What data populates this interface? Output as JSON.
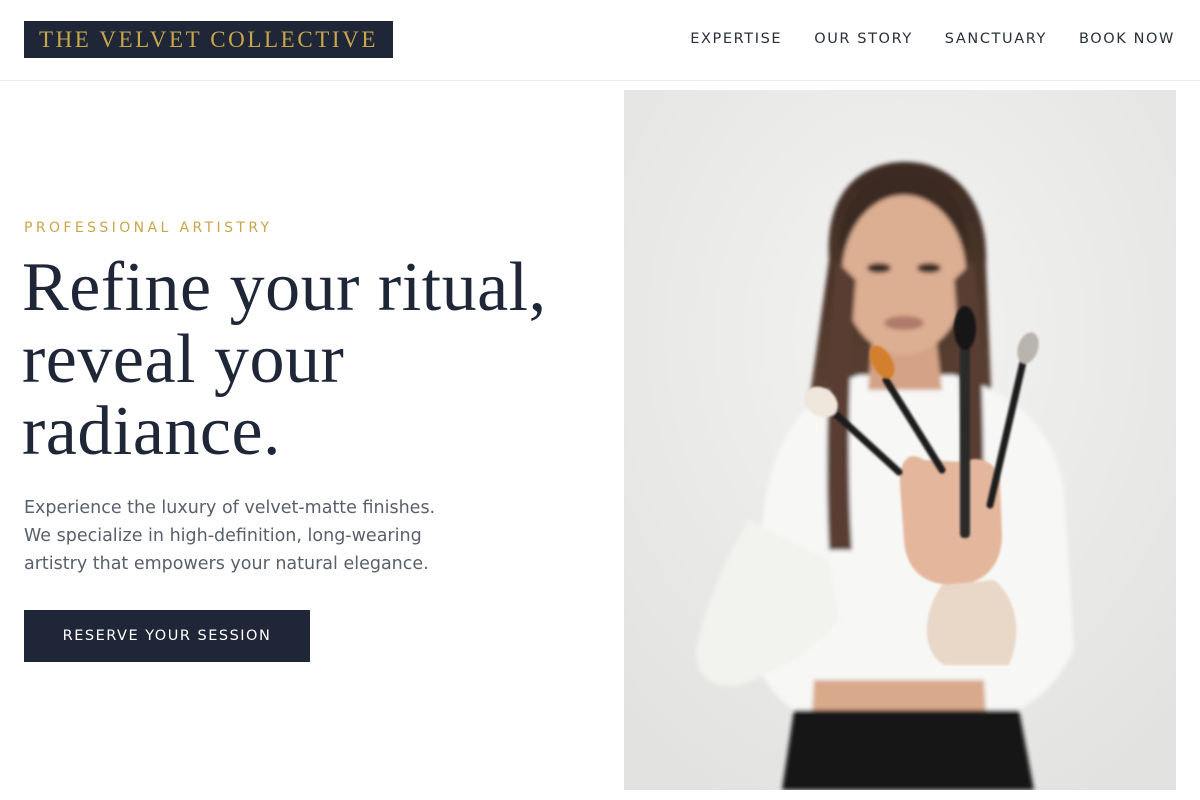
{
  "brand": {
    "name": "THE VELVET COLLECTIVE"
  },
  "nav": {
    "items": [
      {
        "label": "EXPERTISE"
      },
      {
        "label": "OUR STORY"
      },
      {
        "label": "SANCTUARY"
      },
      {
        "label": "BOOK NOW"
      }
    ]
  },
  "hero": {
    "eyebrow": "PROFESSIONAL ARTISTRY",
    "headline": [
      "Refine your ritual,",
      "reveal your",
      "radiance."
    ],
    "description": "Experience the luxury of velvet-matte finishes. We specialize in high-definition, long-wearing artistry that empowers your natural elegance.",
    "cta_label": "RESERVE YOUR SESSION"
  },
  "colors": {
    "navy": "#1e2638",
    "gold": "#c9a64a",
    "body_text": "#595f6b"
  }
}
